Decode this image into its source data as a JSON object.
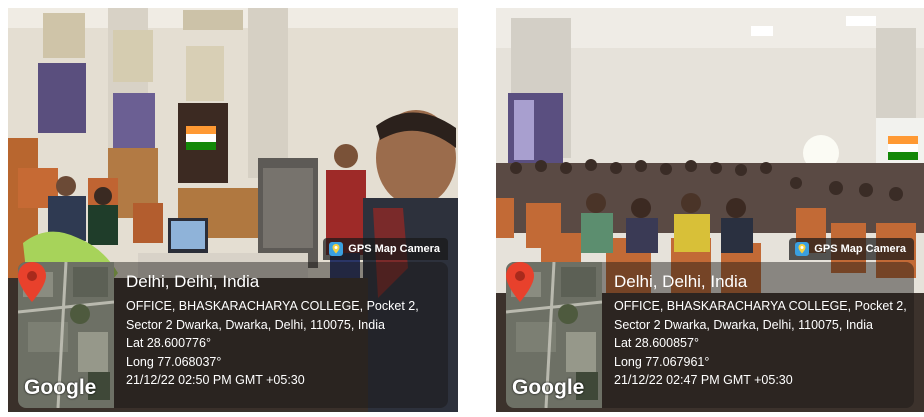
{
  "photos": [
    {
      "badge": "GPS Map Camera",
      "city": "Delhi, Delhi, India",
      "address_line1": "OFFICE, BHASKARACHARYA COLLEGE, Pocket 2,",
      "address_line2": "Sector 2 Dwarka, Dwarka, Delhi, 110075, India",
      "lat": "Lat 28.600776°",
      "long": "Long 77.068037°",
      "datetime": "21/12/22 02:50 PM GMT +05:30",
      "map_logo": "Google"
    },
    {
      "badge": "GPS Map Camera",
      "city": "Delhi, Delhi, India",
      "address_line1": "OFFICE, BHASKARACHARYA COLLEGE, Pocket 2,",
      "address_line2": "Sector 2 Dwarka, Dwarka, Delhi, 110075, India",
      "lat": "Lat 28.600857°",
      "long": "Long 77.067961°",
      "datetime": "21/12/22 02:47 PM GMT +05:30",
      "map_logo": "Google"
    }
  ],
  "colors": {
    "wall": "#e6e1d6",
    "seat": "#c66a34",
    "pin": "#e8412c",
    "flag_saffron": "#ff9933",
    "flag_green": "#138808"
  }
}
